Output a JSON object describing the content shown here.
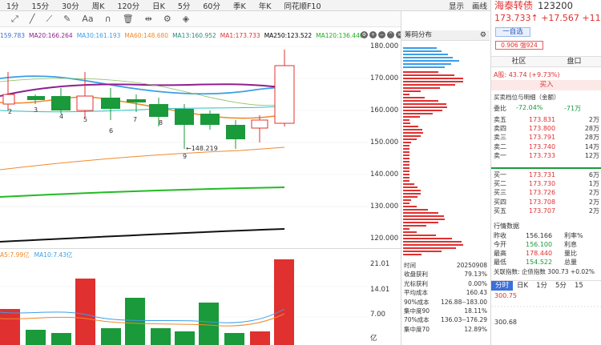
{
  "toolbar": {
    "periods": [
      "1分",
      "15分",
      "30分"
    ],
    "weekK": "周K",
    "p120": "120分",
    "dayK": "日K",
    "p5": "5分",
    "p60": "60分",
    "seasonK": "季K",
    "yearK": "年K",
    "f10": "同花顺F10",
    "show": "显示",
    "draw": "画线"
  },
  "ma": {
    "v1": "159.783",
    "ma20": "MA20:166.264",
    "ma30": "MA30:161.193",
    "ma60": "MA60:148.680",
    "ma13": "MA13:160.952",
    "ma1": "MA1:173.733",
    "ma250": "MA250:123.522",
    "ma120": "MA120:136.440"
  },
  "yaxis": [
    "180.000",
    "170.000",
    "160.000",
    "150.000",
    "140.000",
    "130.000",
    "120.000"
  ],
  "waves": [
    "2",
    "3",
    "4",
    "5",
    "6",
    "7",
    "8",
    "9"
  ],
  "low_label": "←148.219",
  "vol": {
    "a5": "A5:7.99亿",
    "ma10": "MA10:7.43亿",
    "y": [
      "21.01",
      "14.01",
      "7.00",
      "亿"
    ]
  },
  "chip": {
    "title": "筹码分布",
    "stats": [
      [
        "时间",
        "20250908"
      ],
      [
        "收盘获利",
        "79.13%"
      ],
      [
        "光标获利",
        "0.00%"
      ],
      [
        "平均成本",
        "160.43"
      ],
      [
        "90%成本",
        "126.88--183.00"
      ],
      [
        "集中度90",
        "18.11%"
      ],
      [
        "70%成本",
        "136.03--176.29"
      ],
      [
        "集中度70",
        "12.89%"
      ]
    ]
  },
  "right": {
    "name": "海泰转债",
    "code": "123200",
    "price": "173.733↑ +17.567 +11.25%",
    "add": "一自选",
    "strength": "0.906 强924",
    "tabs": [
      "社区",
      "盘口"
    ],
    "ashare": "A股: 43.74 (+9.73%)",
    "buy": "买入",
    "depth": "买卖档位与明细（金额）",
    "weibi": "委比",
    "weibi_v": "-72.04%",
    "weibi_r": "-71万",
    "asks": [
      [
        "卖五",
        "173.831",
        "2万"
      ],
      [
        "卖四",
        "173.800",
        "28万"
      ],
      [
        "卖三",
        "173.791",
        "28万"
      ],
      [
        "卖二",
        "173.740",
        "14万"
      ],
      [
        "卖一",
        "173.733",
        "12万"
      ]
    ],
    "bids": [
      [
        "买一",
        "173.731",
        "6万"
      ],
      [
        "买二",
        "173.730",
        "1万"
      ],
      [
        "买三",
        "173.726",
        "2万"
      ],
      [
        "买四",
        "173.708",
        "2万"
      ],
      [
        "买五",
        "173.707",
        "2万"
      ]
    ],
    "quote_title": "行情数据",
    "quote": [
      [
        "昨收",
        "156.166",
        "利率%"
      ],
      [
        "今开",
        "156.100",
        "利息"
      ],
      [
        "最高",
        "178.440",
        "量比"
      ],
      [
        "最低",
        "154.522",
        "总量"
      ]
    ],
    "index": "关联指数: 企债指数 300.73 +0.02%",
    "bottabs": [
      "分时",
      "日K",
      "1分",
      "5分",
      "15"
    ],
    "intraday": [
      "300.75",
      "300.68"
    ]
  },
  "colors": {
    "up": "#e03030",
    "down": "#1a9a3a",
    "ma20": "#8e1f8e",
    "ma30": "#3a9ee8",
    "ma60": "#f0892a"
  }
}
